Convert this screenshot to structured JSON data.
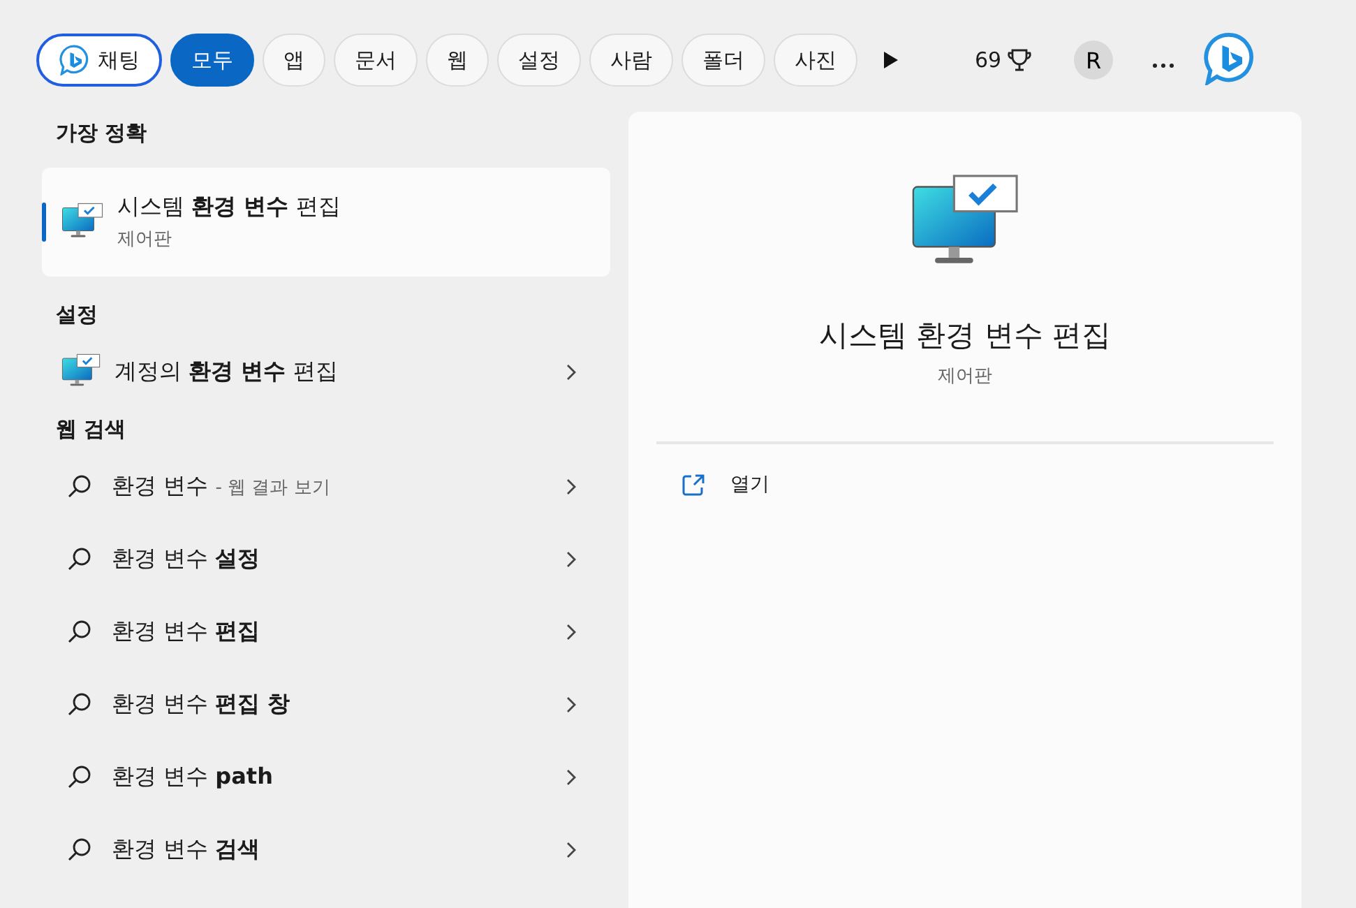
{
  "filters": [
    {
      "label": "채팅",
      "kind": "chat",
      "selected": false
    },
    {
      "label": "모두",
      "kind": "filter",
      "selected": true
    },
    {
      "label": "앱",
      "kind": "filter",
      "selected": false
    },
    {
      "label": "문서",
      "kind": "filter",
      "selected": false
    },
    {
      "label": "웹",
      "kind": "filter",
      "selected": false
    },
    {
      "label": "설정",
      "kind": "filter",
      "selected": false
    },
    {
      "label": "사람",
      "kind": "filter",
      "selected": false
    },
    {
      "label": "폴더",
      "kind": "filter",
      "selected": false
    },
    {
      "label": "사진",
      "kind": "filter",
      "selected": false
    }
  ],
  "points": "69",
  "avatar": "R",
  "best_match": {
    "heading": "가장 정확",
    "title": "시스템 **환경 변수** 편집",
    "subtitle": "제어판",
    "selected": true
  },
  "settings": {
    "heading": "설정",
    "items": [
      {
        "title": "계정의 **환경 변수** 편집"
      }
    ]
  },
  "web_search": {
    "heading": "웹 검색",
    "items": [
      {
        "title": "환경 변수",
        "suffix": "- 웹 결과 보기"
      },
      {
        "title": "환경 변수 **설정**"
      },
      {
        "title": "환경 변수 **편집**"
      },
      {
        "title": "환경 변수 **편집 창**"
      },
      {
        "title": "환경 변수 **path**"
      },
      {
        "title": "환경 변수 **검색**"
      }
    ]
  },
  "detail": {
    "title": "시스템 환경 변수 편집",
    "subtitle": "제어판",
    "actions": [
      {
        "label": "열기"
      }
    ]
  }
}
